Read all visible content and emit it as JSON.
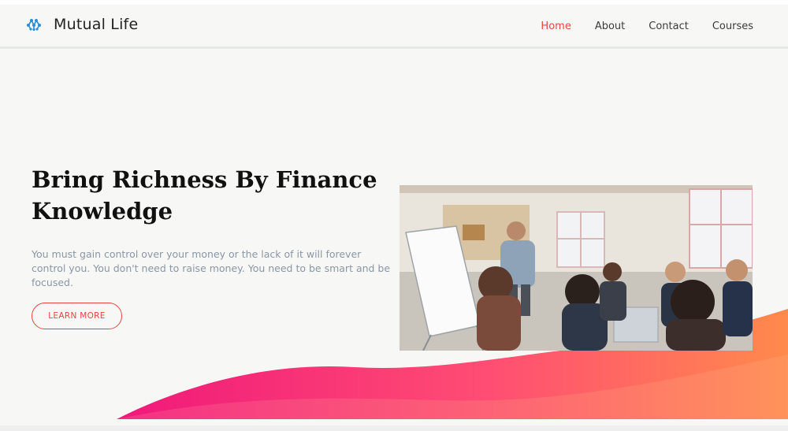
{
  "brand": {
    "name": "Mutual Life",
    "logo_icon": "molecule-logo-icon",
    "logo_color": "#2a8fd6"
  },
  "nav": {
    "items": [
      {
        "label": "Home",
        "active": true
      },
      {
        "label": "About",
        "active": false
      },
      {
        "label": "Contact",
        "active": false
      },
      {
        "label": "Courses",
        "active": false
      }
    ],
    "active_color": "#e8443f"
  },
  "hero": {
    "title": "Bring Richness By Finance Knowledge",
    "text": "You must gain control over your money or the lack of it will forever control you. You don't need to raise money. You need to be smart and be focused.",
    "cta_label": "LEARN MORE",
    "image_alt": "office-meeting-photo"
  },
  "colors": {
    "accent": "#e8443f",
    "wave_start": "#f0187a",
    "wave_end": "#ff8a4c",
    "background": "#f7f8f6"
  }
}
